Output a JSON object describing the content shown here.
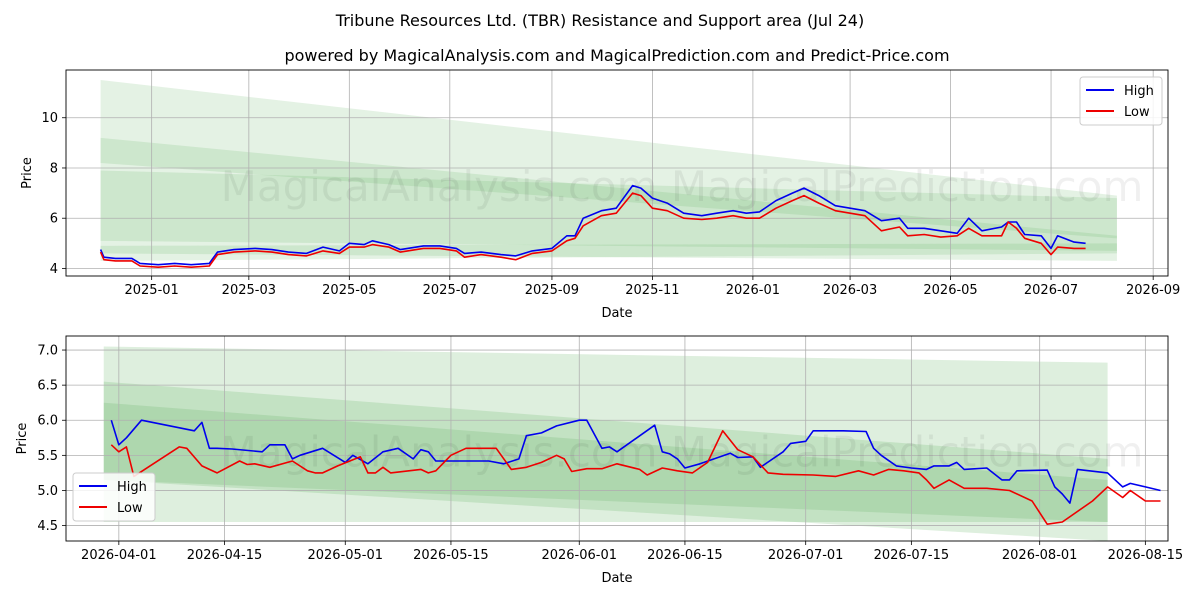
{
  "title": "Tribune Resources Ltd. (TBR) Resistance and Support area (Jul 24)",
  "subtitle": "powered by MagicalAnalysis.com and MagicalPrediction.com and Predict-Price.com",
  "watermark": "MagicalAnalysis.com    MagicalPrediction.com",
  "colors": {
    "high": "#0000ee",
    "low": "#ee0000",
    "band": "#5aaf5a"
  },
  "chart_data": [
    {
      "type": "line",
      "xlabel": "Date",
      "ylabel": "Price",
      "xlim": [
        "2024-11-10",
        "2026-09-10"
      ],
      "ylim": [
        3.7,
        11.9
      ],
      "x_ticks": [
        "2025-01",
        "2025-03",
        "2025-05",
        "2025-07",
        "2025-09",
        "2025-11",
        "2026-01",
        "2026-03",
        "2026-05",
        "2026-07",
        "2026-09"
      ],
      "y_ticks": [
        4,
        6,
        8,
        10
      ],
      "legend": "top-right",
      "grid": true,
      "bands": [
        {
          "x": [
            "2024-12-01",
            "2026-08-10"
          ],
          "lower": [
            8.2,
            5.2
          ],
          "upper": [
            11.5,
            6.9
          ]
        },
        {
          "x": [
            "2024-12-01",
            "2026-08-10"
          ],
          "lower": [
            5.1,
            4.7
          ],
          "upper": [
            7.9,
            6.8
          ]
        },
        {
          "x": [
            "2024-12-01",
            "2026-08-10"
          ],
          "lower": [
            4.6,
            4.3
          ],
          "upper": [
            9.2,
            5.3
          ]
        },
        {
          "x": [
            "2024-12-01",
            "2026-08-10"
          ],
          "lower": [
            4.3,
            4.6
          ],
          "upper": [
            4.9,
            5.0
          ]
        }
      ],
      "series": [
        {
          "name": "High",
          "points": [
            [
              "2024-12-01",
              4.75
            ],
            [
              "2024-12-03",
              4.45
            ],
            [
              "2024-12-10",
              4.4
            ],
            [
              "2024-12-20",
              4.4
            ],
            [
              "2024-12-25",
              4.2
            ],
            [
              "2025-01-05",
              4.15
            ],
            [
              "2025-01-15",
              4.2
            ],
            [
              "2025-01-25",
              4.15
            ],
            [
              "2025-02-05",
              4.2
            ],
            [
              "2025-02-10",
              4.65
            ],
            [
              "2025-02-20",
              4.75
            ],
            [
              "2025-03-05",
              4.8
            ],
            [
              "2025-03-15",
              4.75
            ],
            [
              "2025-03-25",
              4.65
            ],
            [
              "2025-04-05",
              4.6
            ],
            [
              "2025-04-15",
              4.85
            ],
            [
              "2025-04-25",
              4.7
            ],
            [
              "2025-05-01",
              5.0
            ],
            [
              "2025-05-10",
              4.95
            ],
            [
              "2025-05-15",
              5.1
            ],
            [
              "2025-05-25",
              4.95
            ],
            [
              "2025-06-01",
              4.75
            ],
            [
              "2025-06-15",
              4.9
            ],
            [
              "2025-06-25",
              4.9
            ],
            [
              "2025-07-05",
              4.8
            ],
            [
              "2025-07-10",
              4.6
            ],
            [
              "2025-07-20",
              4.65
            ],
            [
              "2025-08-01",
              4.55
            ],
            [
              "2025-08-10",
              4.5
            ],
            [
              "2025-08-20",
              4.7
            ],
            [
              "2025-09-01",
              4.8
            ],
            [
              "2025-09-10",
              5.3
            ],
            [
              "2025-09-15",
              5.3
            ],
            [
              "2025-09-20",
              6.0
            ],
            [
              "2025-10-01",
              6.3
            ],
            [
              "2025-10-10",
              6.4
            ],
            [
              "2025-10-20",
              7.3
            ],
            [
              "2025-10-25",
              7.2
            ],
            [
              "2025-11-01",
              6.8
            ],
            [
              "2025-11-10",
              6.6
            ],
            [
              "2025-11-20",
              6.2
            ],
            [
              "2025-12-01",
              6.1
            ],
            [
              "2025-12-10",
              6.2
            ],
            [
              "2025-12-20",
              6.3
            ],
            [
              "2025-12-28",
              6.2
            ],
            [
              "2026-01-05",
              6.25
            ],
            [
              "2026-01-15",
              6.7
            ],
            [
              "2026-01-25",
              7.0
            ],
            [
              "2026-02-01",
              7.2
            ],
            [
              "2026-02-10",
              6.9
            ],
            [
              "2026-02-20",
              6.5
            ],
            [
              "2026-03-01",
              6.4
            ],
            [
              "2026-03-10",
              6.3
            ],
            [
              "2026-03-20",
              5.9
            ],
            [
              "2026-03-31",
              6.0
            ],
            [
              "2026-04-05",
              5.6
            ],
            [
              "2026-04-15",
              5.6
            ],
            [
              "2026-04-25",
              5.5
            ],
            [
              "2026-05-05",
              5.4
            ],
            [
              "2026-05-12",
              6.0
            ],
            [
              "2026-05-20",
              5.5
            ],
            [
              "2026-06-01",
              5.65
            ],
            [
              "2026-06-05",
              5.85
            ],
            [
              "2026-06-10",
              5.85
            ],
            [
              "2026-06-15",
              5.35
            ],
            [
              "2026-06-25",
              5.3
            ],
            [
              "2026-07-01",
              4.8
            ],
            [
              "2026-07-05",
              5.3
            ],
            [
              "2026-07-15",
              5.05
            ],
            [
              "2026-07-22",
              5.0
            ]
          ]
        },
        {
          "name": "Low",
          "points": [
            [
              "2024-12-01",
              4.65
            ],
            [
              "2024-12-03",
              4.35
            ],
            [
              "2024-12-10",
              4.3
            ],
            [
              "2024-12-20",
              4.3
            ],
            [
              "2024-12-25",
              4.1
            ],
            [
              "2025-01-05",
              4.05
            ],
            [
              "2025-01-15",
              4.1
            ],
            [
              "2025-01-25",
              4.05
            ],
            [
              "2025-02-05",
              4.1
            ],
            [
              "2025-02-10",
              4.55
            ],
            [
              "2025-02-20",
              4.65
            ],
            [
              "2025-03-05",
              4.7
            ],
            [
              "2025-03-15",
              4.65
            ],
            [
              "2025-03-25",
              4.55
            ],
            [
              "2025-04-05",
              4.5
            ],
            [
              "2025-04-15",
              4.7
            ],
            [
              "2025-04-25",
              4.6
            ],
            [
              "2025-05-01",
              4.85
            ],
            [
              "2025-05-10",
              4.85
            ],
            [
              "2025-05-15",
              4.95
            ],
            [
              "2025-05-25",
              4.85
            ],
            [
              "2025-06-01",
              4.65
            ],
            [
              "2025-06-15",
              4.8
            ],
            [
              "2025-06-25",
              4.8
            ],
            [
              "2025-07-05",
              4.7
            ],
            [
              "2025-07-10",
              4.45
            ],
            [
              "2025-07-20",
              4.55
            ],
            [
              "2025-08-01",
              4.45
            ],
            [
              "2025-08-10",
              4.35
            ],
            [
              "2025-08-20",
              4.6
            ],
            [
              "2025-09-01",
              4.7
            ],
            [
              "2025-09-10",
              5.1
            ],
            [
              "2025-09-15",
              5.2
            ],
            [
              "2025-09-20",
              5.7
            ],
            [
              "2025-10-01",
              6.1
            ],
            [
              "2025-10-10",
              6.2
            ],
            [
              "2025-10-20",
              7.0
            ],
            [
              "2025-10-25",
              6.9
            ],
            [
              "2025-11-01",
              6.4
            ],
            [
              "2025-11-10",
              6.3
            ],
            [
              "2025-11-20",
              6.0
            ],
            [
              "2025-12-01",
              5.95
            ],
            [
              "2025-12-10",
              6.0
            ],
            [
              "2025-12-20",
              6.1
            ],
            [
              "2025-12-28",
              6.0
            ],
            [
              "2026-01-05",
              6.0
            ],
            [
              "2026-01-15",
              6.4
            ],
            [
              "2026-01-25",
              6.7
            ],
            [
              "2026-02-01",
              6.9
            ],
            [
              "2026-02-10",
              6.6
            ],
            [
              "2026-02-20",
              6.3
            ],
            [
              "2026-03-01",
              6.2
            ],
            [
              "2026-03-10",
              6.1
            ],
            [
              "2026-03-20",
              5.5
            ],
            [
              "2026-03-31",
              5.65
            ],
            [
              "2026-04-05",
              5.3
            ],
            [
              "2026-04-15",
              5.35
            ],
            [
              "2026-04-25",
              5.25
            ],
            [
              "2026-05-05",
              5.3
            ],
            [
              "2026-05-12",
              5.6
            ],
            [
              "2026-05-20",
              5.3
            ],
            [
              "2026-06-01",
              5.3
            ],
            [
              "2026-06-05",
              5.85
            ],
            [
              "2026-06-10",
              5.6
            ],
            [
              "2026-06-15",
              5.2
            ],
            [
              "2026-06-25",
              5.0
            ],
            [
              "2026-07-01",
              4.55
            ],
            [
              "2026-07-05",
              4.85
            ],
            [
              "2026-07-15",
              4.8
            ],
            [
              "2026-07-22",
              4.8
            ]
          ]
        }
      ]
    },
    {
      "type": "line",
      "xlabel": "Date",
      "ylabel": "Price",
      "xlim": [
        "2026-03-25",
        "2026-08-18"
      ],
      "ylim": [
        4.28,
        7.2
      ],
      "x_ticks": [
        "2026-04-01",
        "2026-04-15",
        "2026-05-01",
        "2026-05-15",
        "2026-06-01",
        "2026-06-15",
        "2026-07-01",
        "2026-07-15",
        "2026-08-01",
        "2026-08-15"
      ],
      "y_ticks": [
        4.5,
        5.0,
        5.5,
        6.0,
        6.5,
        7.0
      ],
      "legend": "bottom-left",
      "grid": true,
      "bands": [
        {
          "x": [
            "2026-03-30",
            "2026-08-10"
          ],
          "lower": [
            5.15,
            4.28
          ],
          "upper": [
            7.05,
            6.82
          ]
        },
        {
          "x": [
            "2026-03-30",
            "2026-08-10"
          ],
          "lower": [
            4.55,
            4.55
          ],
          "upper": [
            6.55,
            5.45
          ]
        },
        {
          "x": [
            "2026-03-30",
            "2026-08-10"
          ],
          "lower": [
            5.15,
            4.55
          ],
          "upper": [
            6.25,
            5.15
          ]
        }
      ],
      "series": [
        {
          "name": "High",
          "points": [
            [
              "2026-03-31",
              6.0
            ],
            [
              "2026-04-01",
              5.65
            ],
            [
              "2026-04-02",
              5.75
            ],
            [
              "2026-04-04",
              6.0
            ],
            [
              "2026-04-11",
              5.85
            ],
            [
              "2026-04-12",
              5.97
            ],
            [
              "2026-04-13",
              5.6
            ],
            [
              "2026-04-14",
              5.6
            ],
            [
              "2026-04-16",
              5.59
            ],
            [
              "2026-04-20",
              5.55
            ],
            [
              "2026-04-21",
              5.65
            ],
            [
              "2026-04-23",
              5.65
            ],
            [
              "2026-04-24",
              5.45
            ],
            [
              "2026-04-25",
              5.5
            ],
            [
              "2026-04-28",
              5.6
            ],
            [
              "2026-05-01",
              5.4
            ],
            [
              "2026-05-02",
              5.5
            ],
            [
              "2026-05-04",
              5.38
            ],
            [
              "2026-05-06",
              5.55
            ],
            [
              "2026-05-08",
              5.6
            ],
            [
              "2026-05-10",
              5.45
            ],
            [
              "2026-05-11",
              5.58
            ],
            [
              "2026-05-12",
              5.55
            ],
            [
              "2026-05-13",
              5.42
            ],
            [
              "2026-05-15",
              5.42
            ],
            [
              "2026-05-20",
              5.42
            ],
            [
              "2026-05-22",
              5.38
            ],
            [
              "2026-05-24",
              5.45
            ],
            [
              "2026-05-25",
              5.78
            ],
            [
              "2026-05-27",
              5.82
            ],
            [
              "2026-05-29",
              5.92
            ],
            [
              "2026-06-01",
              6.0
            ],
            [
              "2026-06-02",
              6.0
            ],
            [
              "2026-06-04",
              5.6
            ],
            [
              "2026-06-05",
              5.62
            ],
            [
              "2026-06-06",
              5.55
            ],
            [
              "2026-06-11",
              5.93
            ],
            [
              "2026-06-12",
              5.55
            ],
            [
              "2026-06-13",
              5.52
            ],
            [
              "2026-06-14",
              5.45
            ],
            [
              "2026-06-15",
              5.32
            ],
            [
              "2026-06-17",
              5.38
            ],
            [
              "2026-06-21",
              5.53
            ],
            [
              "2026-06-22",
              5.47
            ],
            [
              "2026-06-24",
              5.48
            ],
            [
              "2026-06-25",
              5.33
            ],
            [
              "2026-06-28",
              5.55
            ],
            [
              "2026-06-29",
              5.67
            ],
            [
              "2026-07-01",
              5.7
            ],
            [
              "2026-07-02",
              5.85
            ],
            [
              "2026-07-06",
              5.85
            ],
            [
              "2026-07-09",
              5.84
            ],
            [
              "2026-07-10",
              5.6
            ],
            [
              "2026-07-11",
              5.5
            ],
            [
              "2026-07-13",
              5.35
            ],
            [
              "2026-07-15",
              5.32
            ],
            [
              "2026-07-17",
              5.3
            ],
            [
              "2026-07-18",
              5.35
            ],
            [
              "2026-07-20",
              5.35
            ],
            [
              "2026-07-21",
              5.4
            ],
            [
              "2026-07-22",
              5.3
            ],
            [
              "2026-07-25",
              5.32
            ],
            [
              "2026-07-27",
              5.15
            ],
            [
              "2026-07-28",
              5.15
            ],
            [
              "2026-07-29",
              5.28
            ],
            [
              "2026-08-02",
              5.29
            ],
            [
              "2026-08-03",
              5.05
            ],
            [
              "2026-08-04",
              4.95
            ],
            [
              "2026-08-05",
              4.82
            ],
            [
              "2026-08-06",
              5.3
            ],
            [
              "2026-08-10",
              5.25
            ],
            [
              "2026-08-12",
              5.05
            ],
            [
              "2026-08-13",
              5.1
            ],
            [
              "2026-08-15",
              5.05
            ],
            [
              "2026-08-17",
              5.0
            ]
          ]
        }
      ]
    }
  ],
  "legend_labels": {
    "high": "High",
    "low": "Low"
  }
}
